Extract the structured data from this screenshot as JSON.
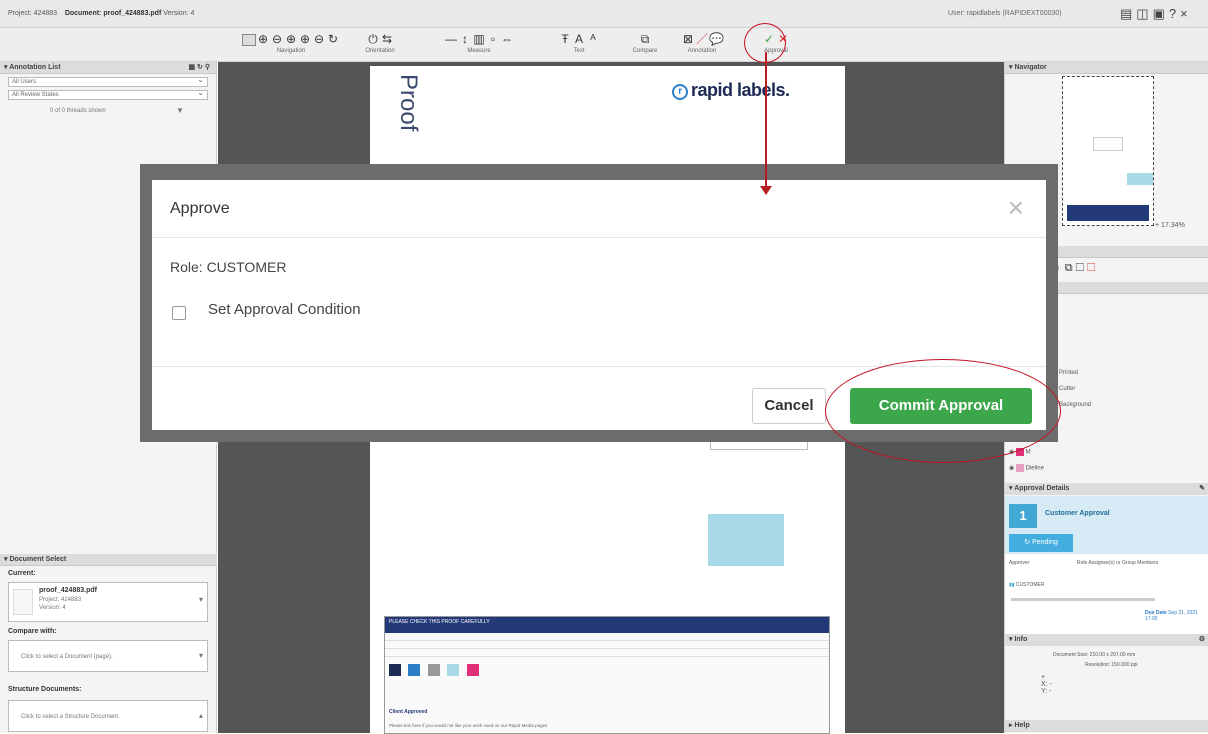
{
  "topbar": {
    "project_label": "Project: 424883",
    "document_label": "Document: proof_424883.pdf",
    "version_label": "Version: 4",
    "user_label": "User: rapidlabels (RAPIDEXT00030)",
    "icon_print": "printer-icon",
    "icon_help": "?",
    "icon_close": "×"
  },
  "toolbar": {
    "navigation_label": "Navigation",
    "orientation_label": "Orientation",
    "measure_label": "Measure",
    "text_label": "Text",
    "compare_label": "Compare",
    "annotation_label": "Annotation",
    "approval_label": "Approval"
  },
  "left_panel": {
    "annotation_list_title": "▾ Annotation List",
    "filter_users": "All Users",
    "filter_states": "All Review States",
    "shown_count": "0 of 0 threads shown",
    "document_select_title": "▾ Document Select",
    "current_label": "Current:",
    "current_doc_name": "proof_424883.pdf",
    "current_doc_project": "Project: 424883",
    "current_doc_version": "Version: 4",
    "compare_label": "Compare with:",
    "compare_placeholder": "Click to select a Document (page).",
    "structure_label": "Structure Documents:",
    "structure_placeholder": "Click to select a Structure Document."
  },
  "document": {
    "proof_word": "Proof",
    "logo_text": "rapid labels.",
    "logo_mark": "r",
    "form_heading": "PLEASE CHECK THIS PROOF CAREFULLY",
    "signature_label": "Client Approved",
    "footer_text": "Please tick here if you would not like your work used on our Rapid Media pages"
  },
  "modal": {
    "title": "Approve",
    "role_text": "Role: CUSTOMER",
    "condition_label": "Set Approval Condition",
    "condition_checked": false,
    "close_symbol": "×",
    "cancel_label": "Cancel",
    "commit_label": "Commit Approval"
  },
  "right_panel": {
    "navigator_title": "▾ Navigator",
    "zoom_text": "17.34%",
    "layer_1": "Printed",
    "layer_2": "Cutter",
    "layer_3": "Background",
    "layer_4": "M",
    "layer_5": "Dieline",
    "approval_title": "▾ Approval Details",
    "approval_number": "1",
    "approval_name": "Customer Approval",
    "pending_label": "Pending",
    "approver_col": "Approver",
    "role_col": "Role Assignee(s) or Group Members",
    "role_value": "CUSTOMER",
    "due_date_label": "Due Date",
    "due_date_value": "Sep 21, 2021 17:00",
    "info_title": "▾ Info",
    "doc_size": "Document Size: 210.00 x 297.00 mm",
    "resolution": "Resolution: 150.000 ppi",
    "help_title": "▸ Help"
  },
  "colors": {
    "accent_green": "#3ba64a",
    "annotation_red": "#c4121f",
    "brand_navy": "#1d2a54",
    "approval_blue": "#41a8d6"
  }
}
